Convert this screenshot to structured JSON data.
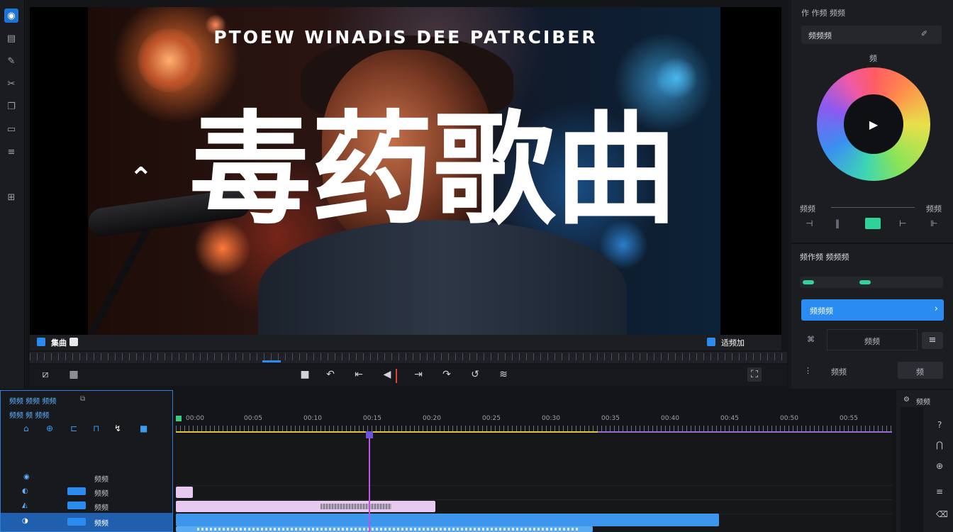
{
  "preview": {
    "video_title": "PTOEW WINADIS DEE PATRCIBER",
    "big_title": "毒药歌曲",
    "bar_left_label": "集曲",
    "bar_right_label": "适频加"
  },
  "toolbar": {
    "icons": [
      "media-icon",
      "import-icon",
      "brush-icon",
      "cut-icon",
      "copy-icon",
      "frame-icon",
      "stack-icon",
      "export-icon"
    ]
  },
  "right_panel": {
    "section1_title": "作 作频 频频",
    "preset_value": "频频频",
    "wheel_label": "频",
    "slider_label_left": "频频",
    "slider_label_right": "频频",
    "section2_title": "频作频 频频频",
    "apply_button": "频频频",
    "field_value": "频频",
    "row_label": "频频",
    "row_button": "频"
  },
  "timeline": {
    "header_title": "频频 频频 频频",
    "header_sub": "频频 频 频频",
    "track_labels": [
      "频频",
      "频频",
      "频频",
      "频频"
    ],
    "ruler_labels": [
      "00:00",
      "00:05",
      "00:10",
      "00:15",
      "00:20",
      "00:25",
      "00:30",
      "00:35",
      "00:40",
      "00:45",
      "00:50",
      "00:55"
    ],
    "side_label": "频频"
  },
  "colors": {
    "accent": "#2a8cf0",
    "playhead": "#c152e8",
    "green": "#2fd39a",
    "clip_pink": "#e8c9f0",
    "clip_blue": "#3d96ec"
  }
}
